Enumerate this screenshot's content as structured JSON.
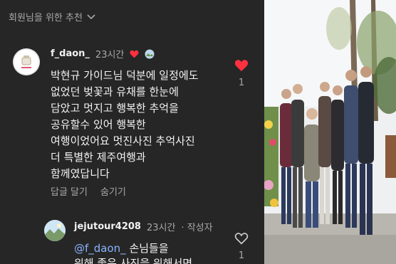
{
  "header": {
    "title": "회원님을 위한 추천"
  },
  "comment": {
    "username": "f_daon_",
    "time": "23시간",
    "lines": [
      "박현규 가이드님 덕분에 일정에도",
      "없었던 벚꽃과 유채를 한눈에",
      "담았고 멋지고 행복한 추억을",
      "공유할수 있어 행복한",
      "여행이었어요 멋진사진 추억사진",
      "더 특별한 제주여행과",
      "함께였답니다"
    ],
    "like_count": "1",
    "actions": {
      "reply": "답글 달기",
      "hide": "숨기기"
    }
  },
  "reply": {
    "username": "jejutour4208",
    "time": "23시간",
    "author_tag": "· 작성자",
    "mention": "@f_daon_",
    "line1_rest": " 손님들을",
    "line2": "위해 좋은 사진을 위해서면",
    "like_count": "1"
  },
  "colors": {
    "accent_like": "#ff3040",
    "background": "#262626",
    "muted": "#a8a8a8"
  },
  "icons": [
    "chevron-down-icon",
    "heart-icon",
    "heart-outline-icon",
    "profile-avatar",
    "photo-thumbnail"
  ]
}
